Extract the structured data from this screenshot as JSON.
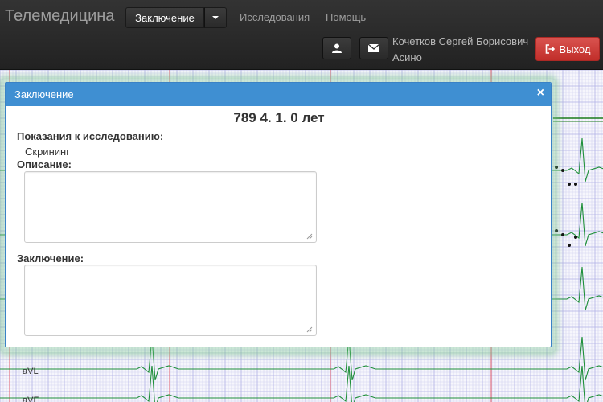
{
  "navbar": {
    "brand": "Телемедицина",
    "conclusion_button": "Заключение",
    "links": [
      "Исследования",
      "Помощь"
    ],
    "user_name": "Кочетков Сергей Борисович",
    "user_city": "Асино",
    "exit_label": "Выход"
  },
  "ecg": {
    "lead_labels": [
      "aVL",
      "aVF"
    ]
  },
  "modal": {
    "title": "Заключение",
    "close_symbol": "×",
    "patient_title": "789 4. 1. 0 лет",
    "indications_label": "Показания к исследованию:",
    "indications_value": "Скрининг",
    "description_label": "Описание:",
    "description_value": "",
    "conclusion_label": "Заключение:",
    "conclusion_value": ""
  }
}
